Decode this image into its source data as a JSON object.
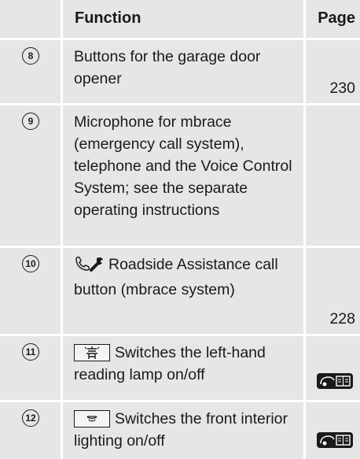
{
  "header": {
    "function": "Function",
    "page": "Page"
  },
  "rows": [
    {
      "num": "8",
      "text": "Buttons for the garage door opener",
      "page": "230"
    },
    {
      "num": "9",
      "text": "Microphone for mbrace (emergency call system), telephone and the Voice Control System; see the separate operating instructions",
      "page": ""
    },
    {
      "num": "10",
      "text": "Roadside Assistance call button (mbrace system)",
      "page": "228",
      "icon": "phone-wrench-icon"
    },
    {
      "num": "11",
      "text": "Switches the left-hand reading lamp on/off",
      "page": "",
      "icon": "reading-lamp-button-icon",
      "page_icon": "vehicle-book-icon"
    },
    {
      "num": "12",
      "text": "Switches the front interior lighting on/off",
      "page": "",
      "icon": "interior-light-button-icon",
      "page_icon": "vehicle-book-icon"
    }
  ],
  "colors": {
    "cell_bg": "#e6e6e6",
    "text": "#1a1a1a"
  }
}
